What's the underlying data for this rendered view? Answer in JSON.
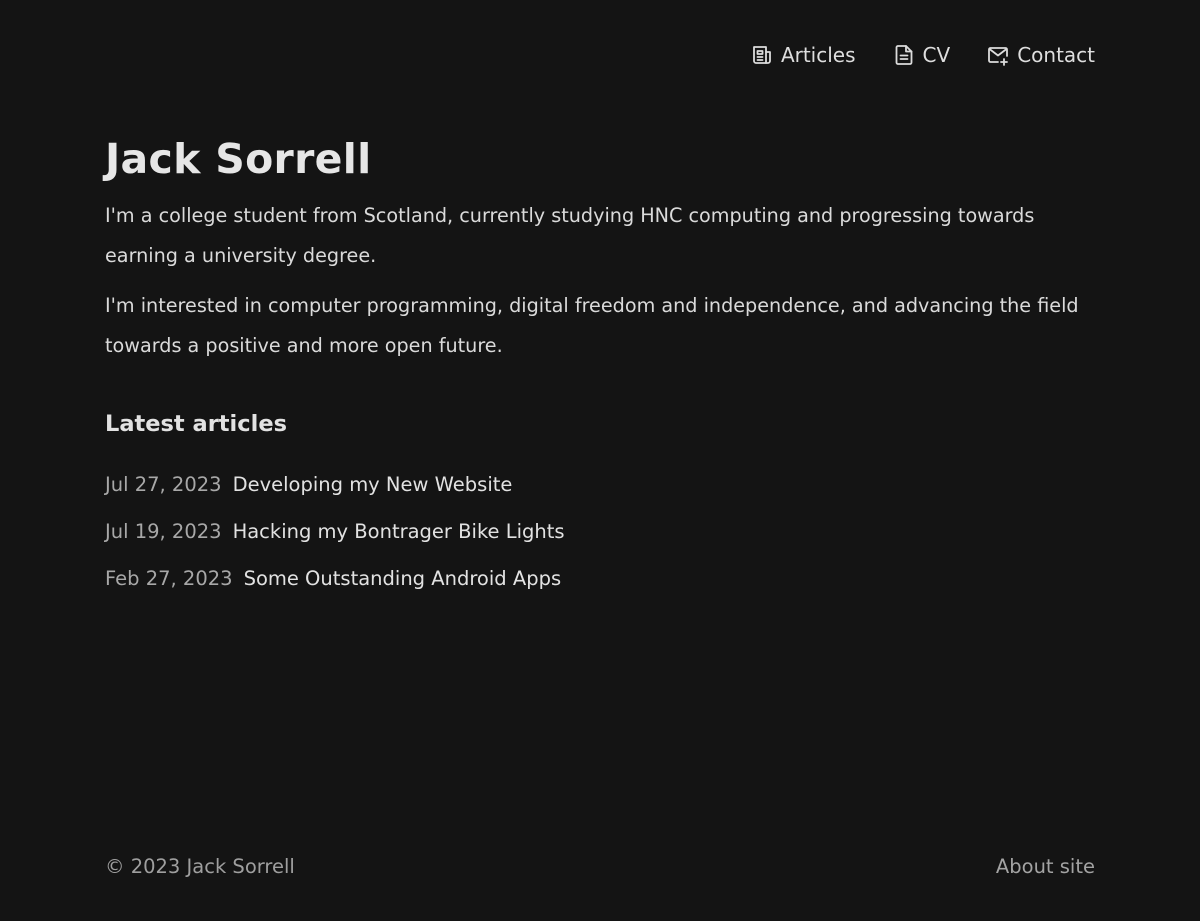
{
  "nav": {
    "items": [
      {
        "label": "Articles",
        "icon": "newspaper-icon"
      },
      {
        "label": "CV",
        "icon": "document-icon"
      },
      {
        "label": "Contact",
        "icon": "mail-plus-icon"
      }
    ]
  },
  "main": {
    "title": "Jack Sorrell",
    "bio": [
      "I'm a college student from Scotland, currently studying HNC computing and progressing towards earning a university degree.",
      "I'm interested in computer programming, digital freedom and independence, and advancing the field towards a positive and more open future."
    ],
    "latest_heading": "Latest articles",
    "articles": [
      {
        "date": "Jul 27, 2023",
        "title": "Developing my New Website"
      },
      {
        "date": "Jul 19, 2023",
        "title": "Hacking my Bontrager Bike Lights"
      },
      {
        "date": "Feb 27, 2023",
        "title": "Some Outstanding Android Apps"
      }
    ]
  },
  "footer": {
    "copyright": "© 2023 Jack Sorrell",
    "about_link": "About site"
  },
  "colors": {
    "background": "#141414",
    "text": "#dcdcdc",
    "muted": "#a8a8a8"
  }
}
